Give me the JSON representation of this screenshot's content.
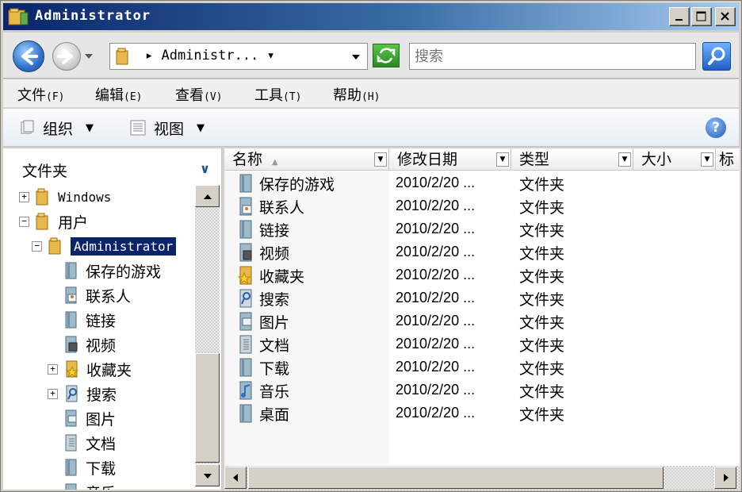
{
  "window": {
    "title": "Administrator"
  },
  "address": {
    "path": "▸ Administr... ▾",
    "search_placeholder": "搜索"
  },
  "menu": [
    {
      "label": "文件",
      "accel": "(F)"
    },
    {
      "label": "编辑",
      "accel": "(E)"
    },
    {
      "label": "查看",
      "accel": "(V)"
    },
    {
      "label": "工具",
      "accel": "(T)"
    },
    {
      "label": "帮助",
      "accel": "(H)"
    }
  ],
  "commands": {
    "organize": "组织",
    "views": "视图"
  },
  "nav": {
    "header": "文件夹",
    "items": [
      {
        "label": "Windows",
        "icon": "folder-icon",
        "expander": "+"
      },
      {
        "label": "用户",
        "icon": "folder-icon",
        "expander": "−"
      },
      {
        "label": "Administrator",
        "icon": "folder-icon",
        "expander": "−"
      },
      {
        "label": "保存的游戏",
        "icon": "saved-games-icon"
      },
      {
        "label": "联系人",
        "icon": "contacts-icon"
      },
      {
        "label": "链接",
        "icon": "links-icon"
      },
      {
        "label": "视频",
        "icon": "videos-icon"
      },
      {
        "label": "收藏夹",
        "icon": "favorites-icon",
        "expander": "+"
      },
      {
        "label": "搜索",
        "icon": "searches-icon",
        "expander": "+"
      },
      {
        "label": "图片",
        "icon": "pictures-icon"
      },
      {
        "label": "文档",
        "icon": "documents-icon"
      },
      {
        "label": "下载",
        "icon": "downloads-icon"
      },
      {
        "label": "音乐",
        "icon": "music-icon"
      }
    ]
  },
  "columns": [
    "名称",
    "修改日期",
    "类型",
    "大小",
    "标"
  ],
  "files": [
    {
      "name": "保存的游戏",
      "date": "2010/2/20  ...",
      "type": "文件夹",
      "icon": "saved-games-icon"
    },
    {
      "name": "联系人",
      "date": "2010/2/20  ...",
      "type": "文件夹",
      "icon": "contacts-icon"
    },
    {
      "name": "链接",
      "date": "2010/2/20  ...",
      "type": "文件夹",
      "icon": "links-icon"
    },
    {
      "name": "视频",
      "date": "2010/2/20  ...",
      "type": "文件夹",
      "icon": "videos-icon"
    },
    {
      "name": "收藏夹",
      "date": "2010/2/20  ...",
      "type": "文件夹",
      "icon": "favorites-icon"
    },
    {
      "name": "搜索",
      "date": "2010/2/20  ...",
      "type": "文件夹",
      "icon": "searches-icon"
    },
    {
      "name": "图片",
      "date": "2010/2/20  ...",
      "type": "文件夹",
      "icon": "pictures-icon"
    },
    {
      "name": "文档",
      "date": "2010/2/20  ...",
      "type": "文件夹",
      "icon": "documents-icon"
    },
    {
      "name": "下载",
      "date": "2010/2/20  ...",
      "type": "文件夹",
      "icon": "downloads-icon"
    },
    {
      "name": "音乐",
      "date": "2010/2/20  ...",
      "type": "文件夹",
      "icon": "music-icon"
    },
    {
      "name": "桌面",
      "date": "2010/2/20  ...",
      "type": "文件夹",
      "icon": "desktop-icon"
    }
  ],
  "colors": {
    "titlebar": "#0a246a",
    "selection": "#0a246a",
    "chrome": "#d4d0c8"
  }
}
